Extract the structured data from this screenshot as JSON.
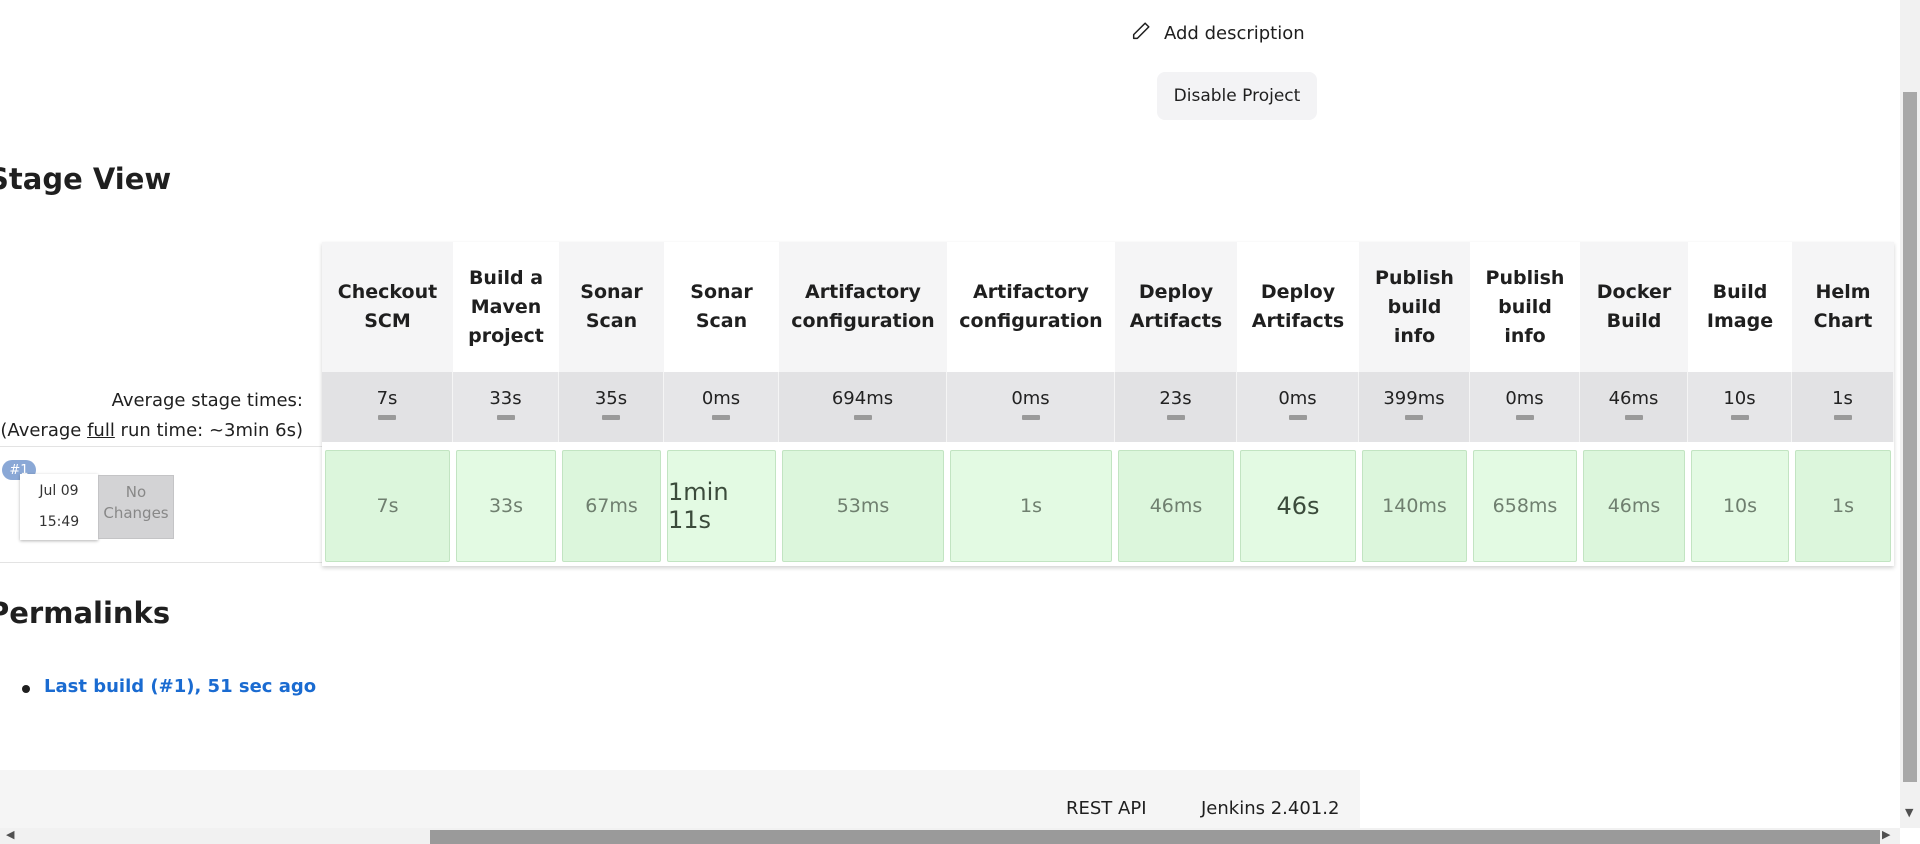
{
  "actions": {
    "add_description": "Add description",
    "disable_project": "Disable Project"
  },
  "stage_view": {
    "title": "Stage View",
    "avg_label_line1": "Average stage times:",
    "avg_label_prefix": "(Average ",
    "avg_label_underlined": "full",
    "avg_label_suffix": " run time: ~3min 6s)",
    "stages": [
      {
        "name": "Checkout SCM",
        "avg": "7s",
        "run": "7s"
      },
      {
        "name": "Build a Maven project",
        "avg": "33s",
        "run": "33s"
      },
      {
        "name": "Sonar Scan",
        "avg": "35s",
        "run": "67ms"
      },
      {
        "name": "Sonar Scan",
        "avg": "0ms",
        "run": "1min 11s"
      },
      {
        "name": "Artifactory configuration",
        "avg": "694ms",
        "run": "53ms"
      },
      {
        "name": "Artifactory configuration",
        "avg": "0ms",
        "run": "1s"
      },
      {
        "name": "Deploy Artifacts",
        "avg": "23s",
        "run": "46ms"
      },
      {
        "name": "Deploy Artifacts",
        "avg": "0ms",
        "run": "46s"
      },
      {
        "name": "Publish build info",
        "avg": "399ms",
        "run": "140ms"
      },
      {
        "name": "Publish build info",
        "avg": "0ms",
        "run": "658ms"
      },
      {
        "name": "Docker Build",
        "avg": "46ms",
        "run": "46ms"
      },
      {
        "name": "Build Image",
        "avg": "10s",
        "run": "10s"
      },
      {
        "name": "Helm Chart",
        "avg": "1s",
        "run": "1s"
      }
    ],
    "build": {
      "badge": "#1",
      "date": "Jul 09",
      "time": "15:49",
      "changes": "No Changes"
    }
  },
  "permalinks": {
    "title": "Permalinks",
    "items": [
      "Last build (#1), 51 sec ago"
    ]
  },
  "footer": {
    "rest_api": "REST API",
    "version": "Jenkins 2.401.2"
  }
}
